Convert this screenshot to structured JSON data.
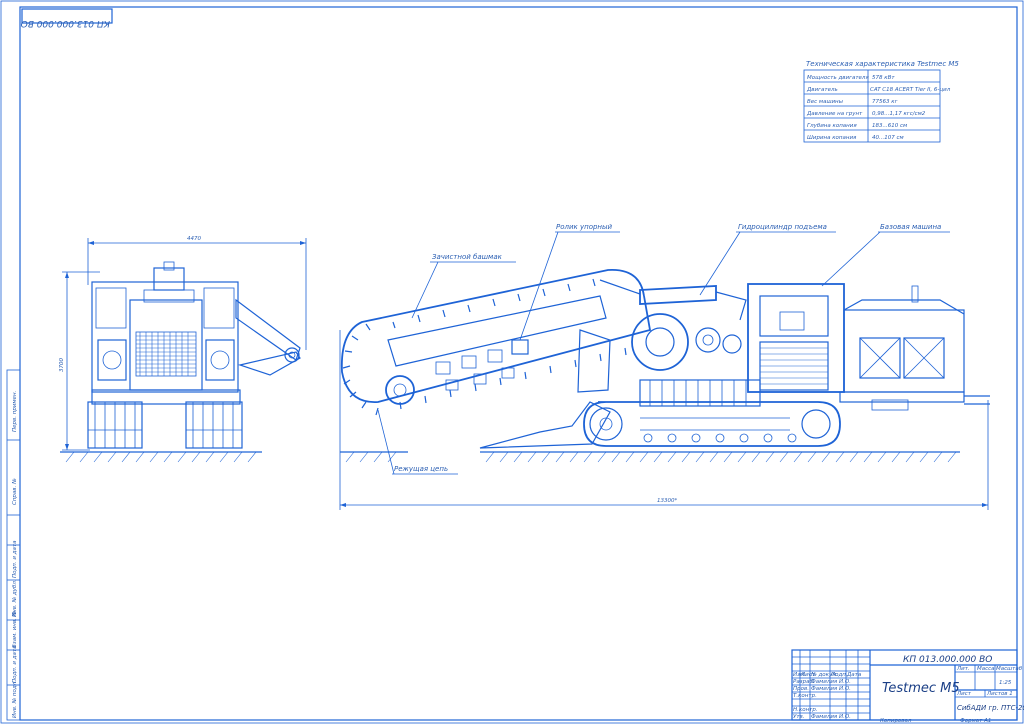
{
  "stamp_code": "КП 013.000.000 ВО",
  "spec_table": {
    "title": "Техническая характеристика Testmec M5",
    "rows": [
      [
        "Мощность двигателя",
        "578 кВт"
      ],
      [
        "Двигатель",
        "CAT C18 ACERT Tier II, 6-цил"
      ],
      [
        "Вес машины",
        "77563 кг"
      ],
      [
        "Давление на грунт",
        "0,98...1,17 кгс/см2"
      ],
      [
        "Глубина копания",
        "183...610 см"
      ],
      [
        "Ширина копания",
        "40...107 см"
      ]
    ]
  },
  "dims": {
    "front_width": "4470",
    "front_height": "3700",
    "side_length": "13300*"
  },
  "callouts": {
    "roller": "Ролик упорный",
    "cylinder": "Гидроцилиндр подъема",
    "base": "Базовая машина",
    "auger": "Зачистной башмак",
    "chain": "Режущая цепь"
  },
  "title_block": {
    "code": "КП 013.000.000 ВО",
    "name": "Testmec M5",
    "org": "СибАДИ гр. ПТС-20Т1",
    "scale": "1:25",
    "sheet": "Лист",
    "sheets": "Листов 1",
    "col_lit": "Лит.",
    "col_mass": "Масса",
    "col_scale": "Масштаб",
    "rows_left": [
      "Изм.",
      "Лист",
      "№ докум.",
      "Подп.",
      "Дата"
    ],
    "roles": [
      "Разраб.",
      "Пров.",
      "Т.контр.",
      "Н.контр.",
      "Утв."
    ],
    "names": [
      "Фамилия И.О.",
      "Фамилия И.О.",
      "",
      "",
      "Фамилия И.О."
    ],
    "copied": "Копировал",
    "format": "Формат А1"
  },
  "side_strip": [
    "Перв. примен.",
    "Справ. №",
    "Подп. и дата",
    "Инв. № дубл.",
    "Взам. инв. №",
    "Подп. и дата",
    "Инв. № подл."
  ]
}
